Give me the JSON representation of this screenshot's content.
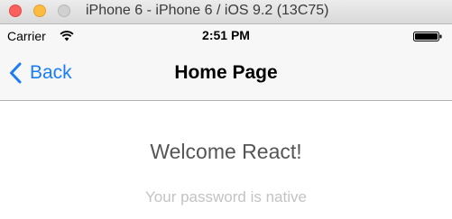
{
  "window": {
    "title": "iPhone 6 - iPhone 6 / iOS 9.2 (13C75)"
  },
  "status_bar": {
    "carrier": "Carrier",
    "time": "2:51 PM",
    "wifi_icon": "wifi-icon",
    "battery_icon": "battery-full-icon"
  },
  "nav_bar": {
    "back_label": "Back",
    "back_icon": "chevron-left-icon",
    "title": "Home Page"
  },
  "content": {
    "welcome": "Welcome React!",
    "subtitle": "Your password is native"
  },
  "colors": {
    "accent": "#1a7df6",
    "welcome_text": "#555555",
    "subtitle_text": "#c3c3c3",
    "bar_background": "#f7f7f7"
  }
}
